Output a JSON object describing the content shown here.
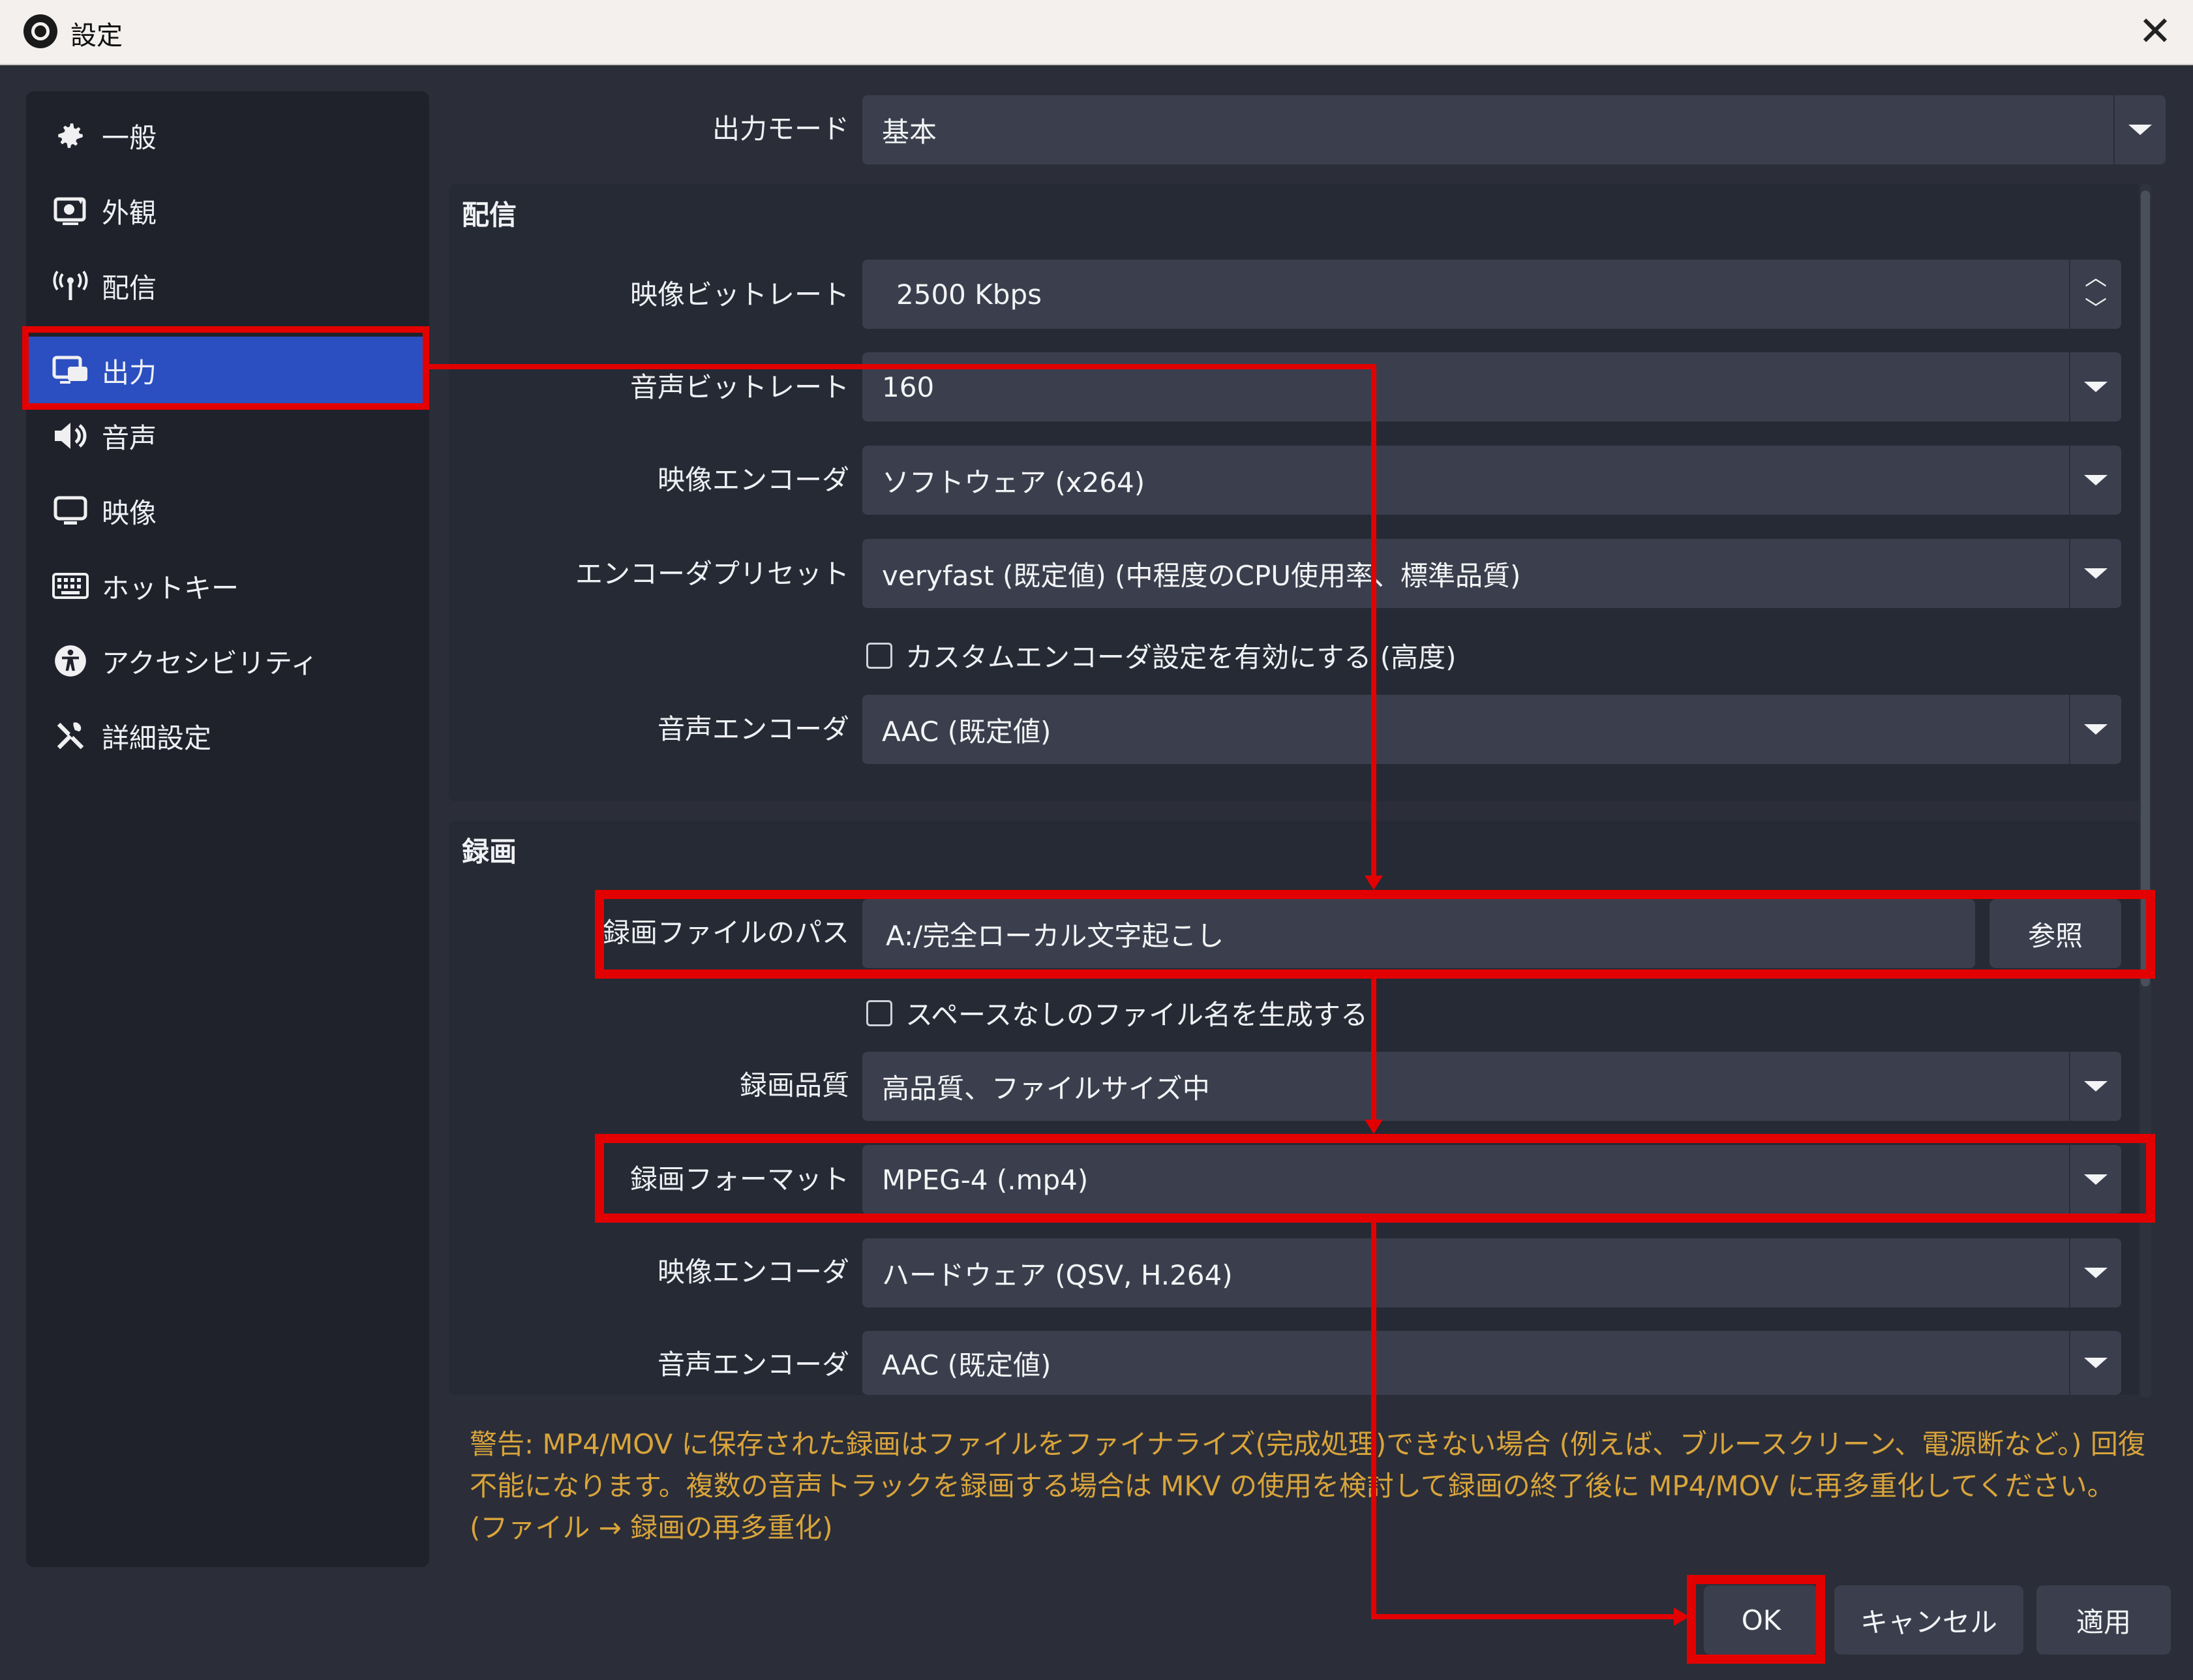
{
  "window": {
    "title": "設定",
    "close_glyph": "✕"
  },
  "sidebar": {
    "items": [
      {
        "label": "一般",
        "icon": "gear-icon"
      },
      {
        "label": "外観",
        "icon": "appearance-icon"
      },
      {
        "label": "配信",
        "icon": "broadcast-icon"
      },
      {
        "label": "出力",
        "icon": "output-icon",
        "selected": true
      },
      {
        "label": "音声",
        "icon": "speaker-icon"
      },
      {
        "label": "映像",
        "icon": "monitor-icon"
      },
      {
        "label": "ホットキー",
        "icon": "keyboard-icon"
      },
      {
        "label": "アクセシビリティ",
        "icon": "accessibility-icon"
      },
      {
        "label": "詳細設定",
        "icon": "tools-icon"
      }
    ]
  },
  "output": {
    "mode_label": "出力モード",
    "mode_value": "基本",
    "streaming": {
      "title": "配信",
      "video_bitrate_label": "映像ビットレート",
      "video_bitrate_value": "2500 Kbps",
      "audio_bitrate_label": "音声ビットレート",
      "audio_bitrate_value": "160",
      "video_encoder_label": "映像エンコーダ",
      "video_encoder_value": "ソフトウェア (x264)",
      "preset_label": "エンコーダプリセット",
      "preset_value": "veryfast (既定値) (中程度のCPU使用率、標準品質)",
      "custom_encoder_checkbox": "カスタムエンコーダ設定を有効にする (高度)",
      "audio_encoder_label": "音声エンコーダ",
      "audio_encoder_value": "AAC (既定値)"
    },
    "recording": {
      "title": "録画",
      "path_label": "録画ファイルのパス",
      "path_value": "A:/完全ローカル文字起こし",
      "browse_button": "参照",
      "nospace_checkbox": "スペースなしのファイル名を生成する",
      "quality_label": "録画品質",
      "quality_value": "高品質、ファイルサイズ中",
      "format_label": "録画フォーマット",
      "format_value": "MPEG-4 (.mp4)",
      "video_encoder_label": "映像エンコーダ",
      "video_encoder_value": "ハードウェア (QSV, H.264)",
      "audio_encoder_label": "音声エンコーダ",
      "audio_encoder_value": "AAC (既定値)"
    },
    "warning": "警告: MP4/MOV に保存された録画はファイルをファイナライズ(完成処理)できない場合 (例えば、ブルースクリーン、電源断など。) 回復不能になります。複数の音声トラックを録画する場合は MKV の使用を検討して録画の終了後に MP4/MOV に再多重化してください。(ファイル → 録画の再多重化)"
  },
  "buttons": {
    "ok": "OK",
    "cancel": "キャンセル",
    "apply": "適用"
  },
  "colors": {
    "highlight": "#e30000",
    "selected": "#2b4fc1",
    "warning": "#d9a43b"
  }
}
